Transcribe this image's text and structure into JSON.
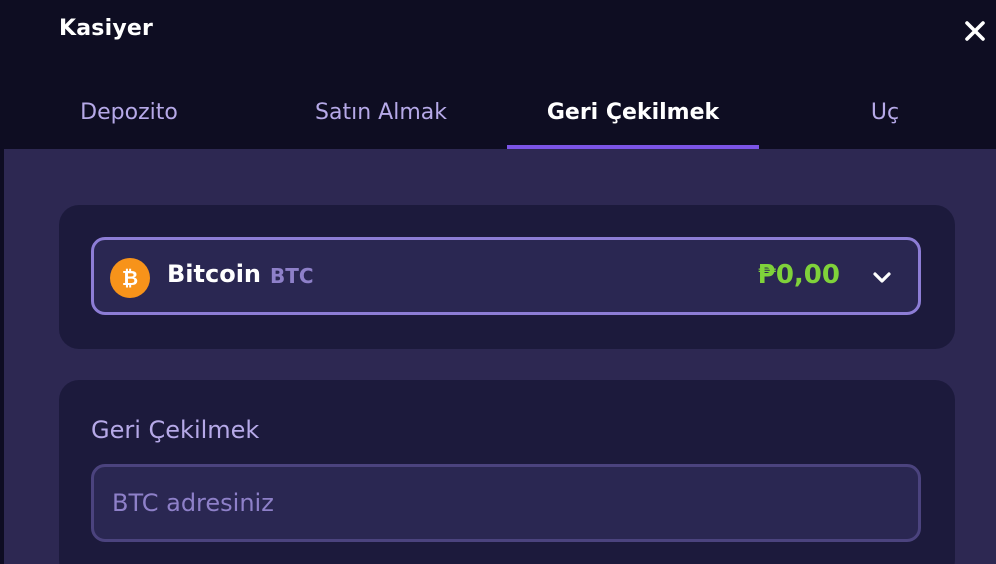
{
  "header": {
    "title": "Kasiyer"
  },
  "tabs": [
    {
      "label": "Depozito",
      "active": false
    },
    {
      "label": "Satın Almak",
      "active": false
    },
    {
      "label": "Geri Çekilmek",
      "active": true
    },
    {
      "label": "Uç",
      "active": false
    }
  ],
  "currency": {
    "name": "Bitcoin",
    "symbol": "BTC",
    "balance": "₱0,00",
    "icon": "bitcoin-icon"
  },
  "withdraw": {
    "label": "Geri Çekilmek",
    "address_placeholder": "BTC adresiniz",
    "address_value": ""
  },
  "colors": {
    "accent": "#7b54e6",
    "balance": "#7fd23a",
    "bitcoin": "#f7931a"
  }
}
